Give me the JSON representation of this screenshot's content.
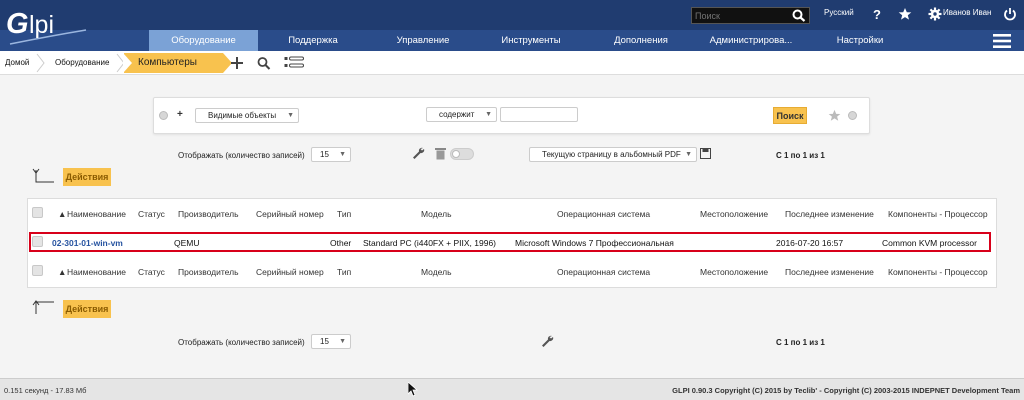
{
  "header": {
    "search_placeholder": "Поиск",
    "language": "Русский",
    "user": "Иванов Иван"
  },
  "menu": [
    {
      "label": "Оборудование",
      "active": true
    },
    {
      "label": "Поддержка"
    },
    {
      "label": "Управление"
    },
    {
      "label": "Инструменты"
    },
    {
      "label": "Дополнения"
    },
    {
      "label": "Администрирова..."
    },
    {
      "label": "Настройки"
    }
  ],
  "breadcrumb": {
    "home": "Домой",
    "section": "Оборудование",
    "current": "Компьютеры"
  },
  "search_panel": {
    "criteria_field": "Видимые объекты",
    "operator": "содержит",
    "value": "",
    "search_button": "Поиск"
  },
  "pager": {
    "display_label": "Отображать (количество записей)",
    "page_size": "15",
    "export_option": "Текущую страницу в альбомный PDF",
    "range": "С 1 по 1 из 1"
  },
  "actions_label": "Действия",
  "table": {
    "columns": [
      "Наименование",
      "Статус",
      "Производитель",
      "Серийный номер",
      "Тип",
      "Модель",
      "Операционная система",
      "Местоположение",
      "Последнее изменение",
      "Компоненты - Процессор"
    ],
    "rows": [
      [
        "02-301-01-win-vm",
        "",
        "QEMU",
        "",
        "Other",
        "Standard PC (i440FX + PIIX, 1996)",
        "Microsoft Windows 7 Профессиональная",
        "",
        "2016-07-20 16:57",
        "Common KVM processor"
      ]
    ]
  },
  "footer": {
    "stats": "0.151 секунд - 17.83 Мб",
    "copyright": "GLPI 0.90.3 Copyright (C) 2015 by Teclib' - Copyright (C) 2003-2015 INDEPNET Development Team"
  },
  "colors": {
    "header_dark": "#203c70",
    "menu_bar": "#2a4c8a",
    "menu_active": "#7ba2d6",
    "accent_yellow": "#f8c24e",
    "highlight_red": "#d8001a"
  }
}
